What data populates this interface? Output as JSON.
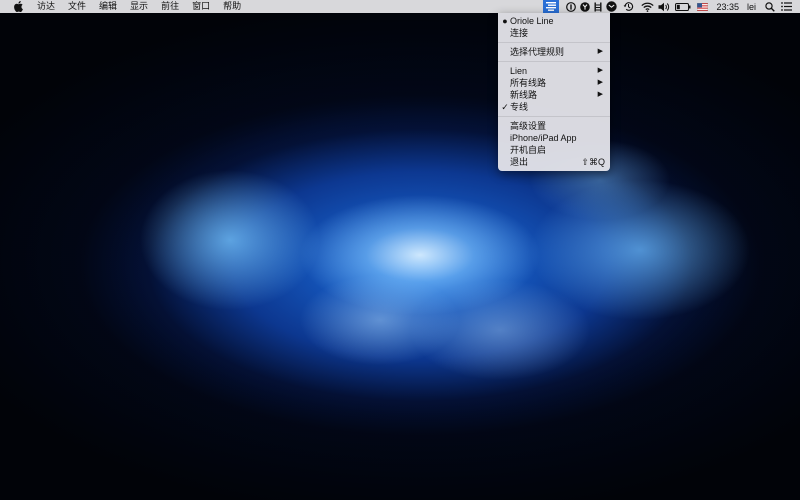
{
  "menubar": {
    "apple_icon": "apple-logo-icon",
    "items": [
      {
        "label": "访达"
      },
      {
        "label": "文件"
      },
      {
        "label": "编辑"
      },
      {
        "label": "显示"
      },
      {
        "label": "前往"
      },
      {
        "label": "窗口"
      },
      {
        "label": "帮助"
      }
    ]
  },
  "status_bar": {
    "icons": [
      "vpn-lines-icon",
      "password-manager-icon",
      "y-app-icon",
      "bartender-icon",
      "mail-icon",
      "time-machine-icon",
      "wifi-icon",
      "volume-icon",
      "battery-icon",
      "us-flag-input-icon"
    ],
    "clock": "23:35",
    "user": "lei",
    "search_icon": "spotlight-search-icon",
    "notification_icon": "notification-center-icon",
    "accent": "#2a6fd6"
  },
  "dropdown": {
    "sections": [
      [
        {
          "label": "Oriole Line",
          "mark": "●",
          "submenu": false,
          "shortcut": ""
        },
        {
          "label": "连接",
          "mark": "",
          "submenu": false,
          "shortcut": ""
        }
      ],
      [
        {
          "label": "选择代理规则",
          "mark": "",
          "submenu": true,
          "shortcut": ""
        }
      ],
      [
        {
          "label": "Lien",
          "mark": "",
          "submenu": true,
          "shortcut": ""
        },
        {
          "label": "所有线路",
          "mark": "",
          "submenu": true,
          "shortcut": ""
        },
        {
          "label": "新线路",
          "mark": "",
          "submenu": true,
          "shortcut": ""
        },
        {
          "label": "专线",
          "mark": "✓",
          "submenu": false,
          "shortcut": ""
        }
      ],
      [
        {
          "label": "高级设置",
          "mark": "",
          "submenu": false,
          "shortcut": ""
        },
        {
          "label": "iPhone/iPad App",
          "mark": "",
          "submenu": false,
          "shortcut": ""
        },
        {
          "label": "开机自启",
          "mark": "",
          "submenu": false,
          "shortcut": ""
        },
        {
          "label": "退出",
          "mark": "",
          "submenu": false,
          "shortcut": "⇧⌘Q"
        }
      ]
    ],
    "submenu_arrow": "▶"
  }
}
